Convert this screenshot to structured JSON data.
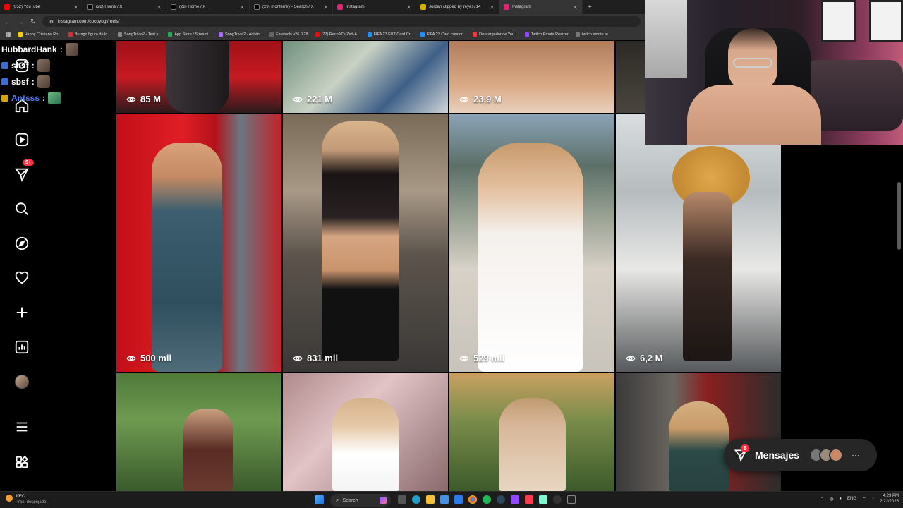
{
  "browser": {
    "tabs": [
      {
        "title": "(652) YouTube",
        "color": "#ff0000",
        "active": false
      },
      {
        "title": "(28) Home / X",
        "color": "#000000",
        "active": false
      },
      {
        "title": "(28) Home / X",
        "color": "#000000",
        "active": false
      },
      {
        "title": "(29) monterrey - Search / X",
        "color": "#000000",
        "active": false
      },
      {
        "title": "Instagram",
        "color": "#d62976",
        "active": false
      },
      {
        "title": "Jordan clipped by reyes714",
        "color": "#9146ff",
        "active": false
      },
      {
        "title": "Instagram",
        "color": "#d62976",
        "active": true
      }
    ],
    "url": "instagram.com/cocoyogi/reels/",
    "bookmarks": [
      {
        "label": "Happy Cristiano Ro...",
        "color": "#ffcc00"
      },
      {
        "label": "Burago figura de lo...",
        "color": "#cc3333"
      },
      {
        "label": "SongTrivia2 - Test y...",
        "color": "#888888"
      },
      {
        "label": "App Store / Streami...",
        "color": "#22aa55"
      },
      {
        "label": "SongTrivia2 - Adivin...",
        "color": "#aa66ff"
      },
      {
        "label": "Fatetools v26.0.28",
        "color": "#666666"
      },
      {
        "label": "(77) Raco97's Zed-A...",
        "color": "#ff0000"
      },
      {
        "label": "FIFA 23 FUT Card Cr...",
        "color": "#1e90ff"
      },
      {
        "label": "FIFA 23 Card creator...",
        "color": "#1e90ff"
      },
      {
        "label": "Descargador de You...",
        "color": "#ff3333"
      },
      {
        "label": "Twitch Emote Resizer",
        "color": "#9146ff"
      },
      {
        "label": "twitch emote re",
        "color": "#777777"
      }
    ]
  },
  "chat": [
    {
      "user": "HubbardHank",
      "color": "#ffffff",
      "badge": "",
      "has_emote": true
    },
    {
      "user": "sbsf",
      "color": "#ffffff",
      "badge": "blue",
      "has_emote": true
    },
    {
      "user": "sbsf",
      "color": "#ffffff",
      "badge": "blue",
      "has_emote": true
    },
    {
      "user": "Antsss",
      "color": "#4a7dff",
      "badge": "yellow",
      "has_emote": true
    }
  ],
  "sidebar": {
    "notification_count": "9+"
  },
  "reels": [
    {
      "views": "85 M"
    },
    {
      "views": "221 M"
    },
    {
      "views": "23,9 M"
    },
    {
      "views": ""
    },
    {
      "views": "500 mil"
    },
    {
      "views": "831 mil"
    },
    {
      "views": "529 mil"
    },
    {
      "views": "6,2 M"
    },
    {
      "views": ""
    },
    {
      "views": ""
    },
    {
      "views": ""
    },
    {
      "views": ""
    }
  ],
  "messages": {
    "label": "Mensajes",
    "count": "8"
  },
  "taskbar": {
    "temperature": "13°C",
    "weather": "Prac. despejado",
    "search": "Search",
    "lang": "ENG",
    "time": "4:29 PM",
    "date": "2/22/2026"
  }
}
